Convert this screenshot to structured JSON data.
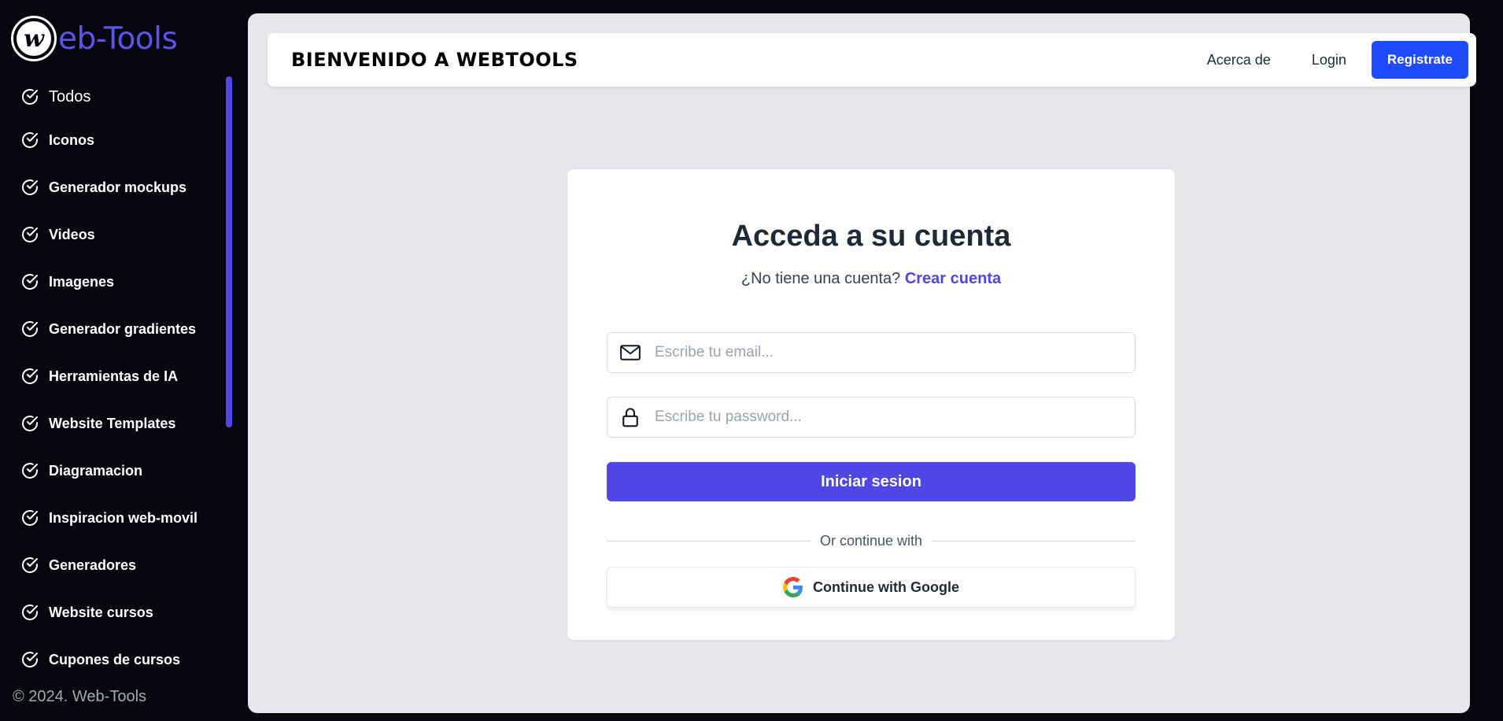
{
  "sidebar": {
    "logo_letter": "w",
    "logo_text": "eb-Tools",
    "items": [
      {
        "label": "Todos"
      },
      {
        "label": "Iconos"
      },
      {
        "label": "Generador mockups"
      },
      {
        "label": "Videos"
      },
      {
        "label": "Imagenes"
      },
      {
        "label": "Generador gradientes"
      },
      {
        "label": "Herramientas de IA"
      },
      {
        "label": "Website Templates"
      },
      {
        "label": "Diagramacion"
      },
      {
        "label": "Inspiracion web-movil"
      },
      {
        "label": "Generadores"
      },
      {
        "label": "Website cursos"
      },
      {
        "label": "Cupones de cursos"
      }
    ],
    "item_icon": "check-circle-icon",
    "copyright": "© 2024. Web-Tools"
  },
  "header": {
    "title": "BIENVENIDO A WEBTOOLS",
    "nav": {
      "about": "Acerca de",
      "login": "Login",
      "register": "Registrate"
    }
  },
  "login": {
    "title": "Acceda a su cuenta",
    "subtitle": "¿No tiene una cuenta?",
    "create_link": "Crear cuenta",
    "email_placeholder": "Escribe tu email...",
    "email_icon": "mail-icon",
    "password_placeholder": "Escribe tu password...",
    "password_icon": "lock-icon",
    "submit_label": "Iniciar sesion",
    "divider_text": "Or continue with",
    "google_label": "Continue with Google",
    "google_icon": "google-icon"
  },
  "colors": {
    "accent": "#4f46e5",
    "register_button": "#1e4bff",
    "sidebar_bg": "#05060f",
    "main_bg": "#e5e7eb"
  }
}
